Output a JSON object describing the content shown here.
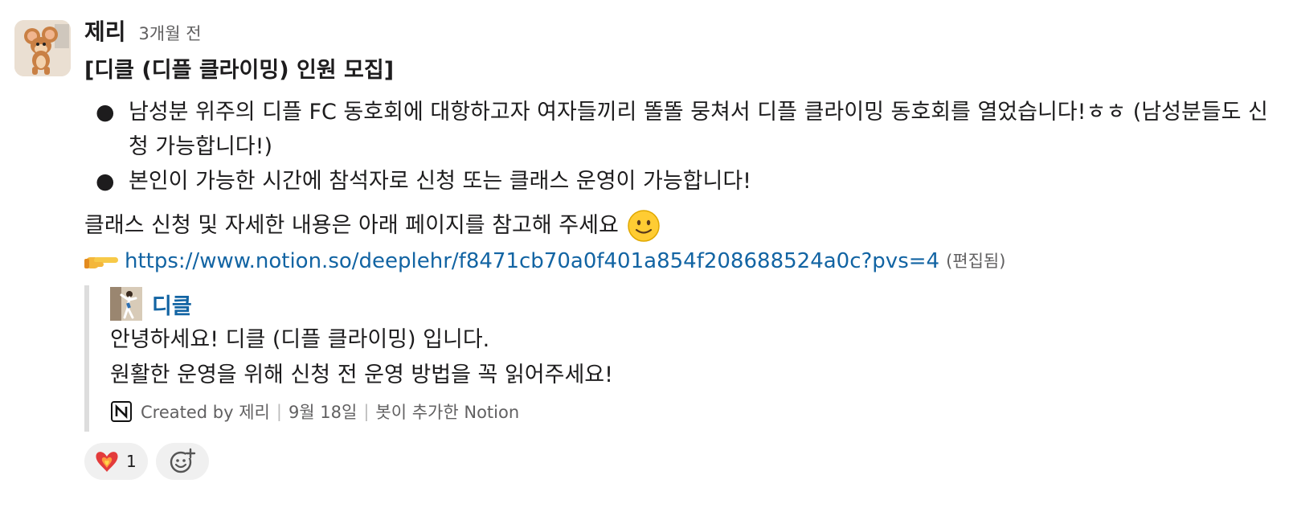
{
  "message": {
    "author": "제리",
    "timestamp": "3개월 전",
    "title": "[디클 (디플 클라이밍) 인원 모집]",
    "bullets": [
      "남성분 위주의 디플 FC 동호회에 대항하고자 여자들끼리 똘똘 뭉쳐서 디플 클라이밍 동호회를 열었습니다!ㅎㅎ (남성분들도 신청 가능합니다!)",
      "본인이 가능한 시간에 참석자로 신청 또는 클래스 운영이 가능합니다!"
    ],
    "paragraph": "클래스 신청 및 자세한 내용은 아래 페이지를 참고해 주세요",
    "link": "https://www.notion.so/deeplehr/f8471cb70a0f401a854f208688524a0c?pvs=4",
    "edited": "(편집됨)"
  },
  "attachment": {
    "title": "디클",
    "lines": [
      "안녕하세요! 디클 (디플 클라이밍) 입니다.",
      "원활한 운영을 위해 신청 전 운영 방법을 꼭 읽어주세요!"
    ],
    "footer": {
      "created_by": "Created by 제리",
      "date": "9월 18일",
      "source": "봇이 추가한 Notion"
    }
  },
  "reactions": [
    {
      "icon": "heart-on-fire-icon",
      "count": "1"
    }
  ],
  "icons": {
    "avatar": "jerry-mouse-avatar",
    "smiley": "slightly-smiling-face-icon",
    "pointer": "pointing-right-hand-icon",
    "notion": "notion-icon",
    "add_reaction": "add-reaction-icon"
  },
  "colors": {
    "link": "#1264a3",
    "muted": "#616061",
    "reaction_bg": "#f0f0f0"
  }
}
